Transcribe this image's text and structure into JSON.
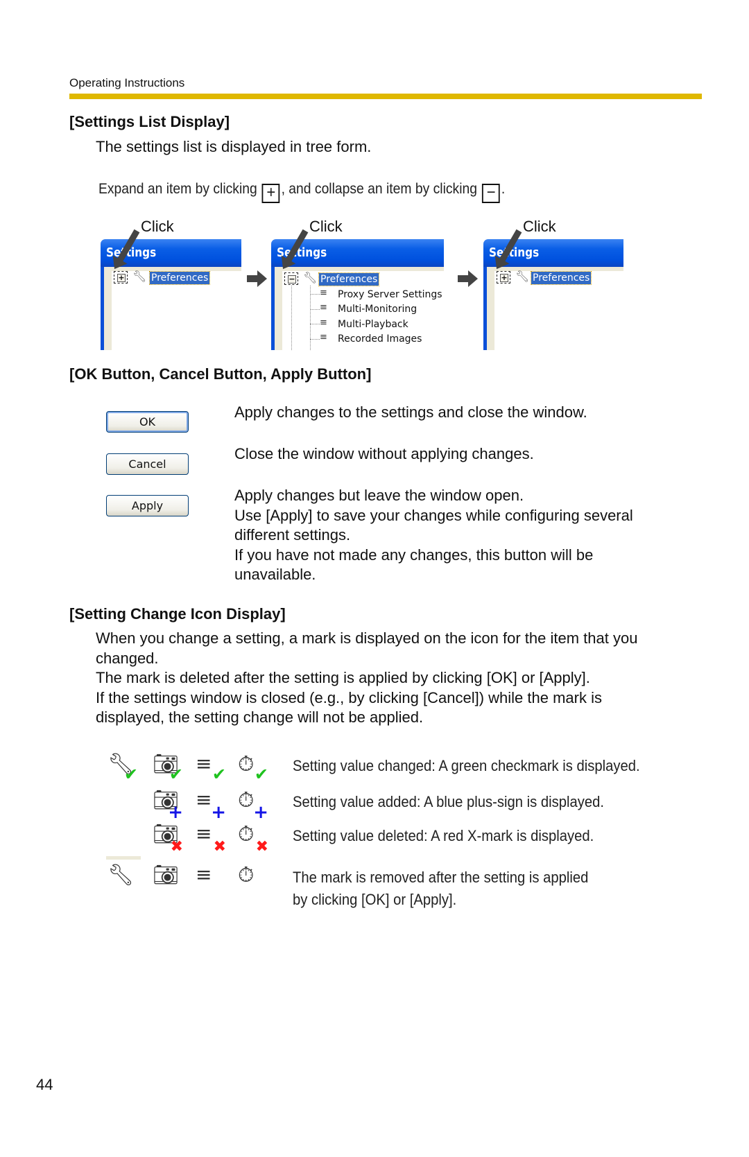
{
  "header": {
    "title": "Operating Instructions",
    "accent_color": "#dfb800"
  },
  "settings_list": {
    "heading": "[Settings List Display]",
    "intro": "The settings list is displayed in tree form.",
    "expand_text_1": "Expand an item by clicking",
    "expand_icon": "+",
    "expand_text_2": ", and collapse an item by clicking",
    "collapse_icon": "−",
    "expand_text_3": ".",
    "click_label": "Click",
    "window_title": "Settings",
    "root_item": "Preferences",
    "children": [
      "Proxy Server Settings",
      "Multi-Monitoring",
      "Multi-Playback",
      "Recorded Images"
    ]
  },
  "buttons_section": {
    "heading": "[OK Button, Cancel Button, Apply Button]",
    "ok_label": "OK",
    "cancel_label": "Cancel",
    "apply_label": "Apply",
    "ok_desc": "Apply changes to the settings and close the window.",
    "cancel_desc": "Close the window without applying changes.",
    "apply_desc": [
      "Apply changes but leave the window open.",
      "Use [Apply] to save your changes while configuring several",
      "different settings.",
      "If you have not made any changes, this button will be",
      "unavailable."
    ]
  },
  "icon_section": {
    "heading": "[Setting Change Icon Display]",
    "paragraph": [
      "When you change a setting, a mark is displayed on the icon for the item that you",
      "changed.",
      "The mark is deleted after the setting is applied by clicking [OK] or [Apply].",
      "If the settings window is closed (e.g., by clicking [Cancel]) while the mark is",
      "displayed, the setting change will not be applied."
    ],
    "captions": {
      "changed": "Setting value changed: A green checkmark is displayed.",
      "added": "Setting value added: A blue plus-sign is displayed.",
      "deleted": "Setting value deleted: A red X-mark is displayed.",
      "removed_1": "The mark is removed after the setting is applied",
      "removed_2": "by clicking [OK] or [Apply]."
    },
    "mark_colors": {
      "changed": "#1fc21f",
      "added": "#1414e6",
      "deleted": "#ff1a1a"
    }
  },
  "page_number": "44"
}
